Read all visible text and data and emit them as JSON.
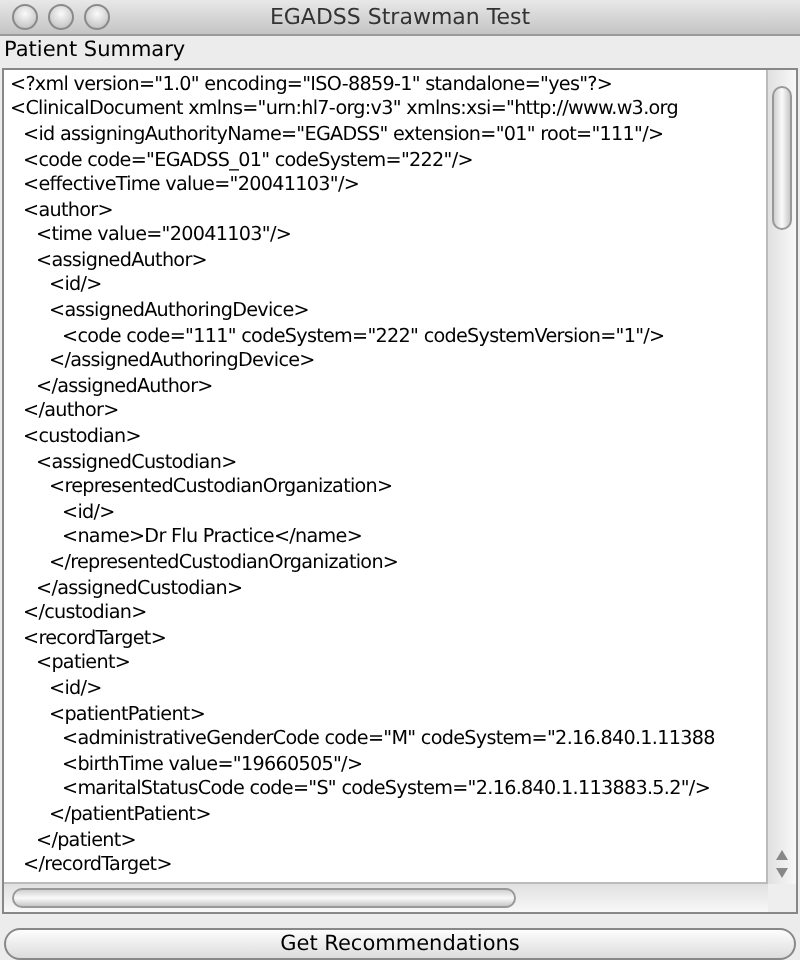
{
  "window": {
    "title": "EGADSS Strawman Test"
  },
  "panel_label": "Patient Summary",
  "document": {
    "lines": [
      {
        "text": "<?xml version=\"1.0\" encoding=\"ISO-8859-1\" standalone=\"yes\"?>"
      },
      {
        "text": "<ClinicalDocument xmlns=\"urn:hl7-org:v3\" xmlns:xsi=\"http://www.w3.org",
        "children": [
          {
            "text": "<id assigningAuthorityName=\"EGADSS\" extension=\"01\" root=\"111\"/>"
          },
          {
            "text": "<code code=\"EGADSS_01\" codeSystem=\"222\"/>"
          },
          {
            "text": "<effectiveTime value=\"20041103\"/>"
          },
          {
            "text": "<author>",
            "children": [
              {
                "text": "<time value=\"20041103\"/>"
              },
              {
                "text": "<assignedAuthor>",
                "children": [
                  {
                    "text": "<id/>"
                  },
                  {
                    "text": "<assignedAuthoringDevice>",
                    "children": [
                      {
                        "text": "<code code=\"111\" codeSystem=\"222\" codeSystemVersion=\"1\"/>"
                      }
                    ]
                  },
                  {
                    "text": "</assignedAuthoringDevice>"
                  }
                ]
              },
              {
                "text": "</assignedAuthor>"
              }
            ]
          },
          {
            "text": "</author>"
          },
          {
            "text": "<custodian>",
            "children": [
              {
                "text": "<assignedCustodian>",
                "children": [
                  {
                    "text": "<representedCustodianOrganization>",
                    "children": [
                      {
                        "text": "<id/>"
                      },
                      {
                        "text": "<name>Dr Flu Practice</name>"
                      }
                    ]
                  },
                  {
                    "text": "</representedCustodianOrganization>"
                  }
                ]
              },
              {
                "text": "</assignedCustodian>"
              }
            ]
          },
          {
            "text": "</custodian>"
          },
          {
            "text": "<recordTarget>",
            "children": [
              {
                "text": "<patient>",
                "children": [
                  {
                    "text": "<id/>"
                  },
                  {
                    "text": "<patientPatient>",
                    "children": [
                      {
                        "text": "<administrativeGenderCode code=\"M\" codeSystem=\"2.16.840.1.11388"
                      },
                      {
                        "text": "<birthTime value=\"19660505\"/>"
                      },
                      {
                        "text": "<maritalStatusCode code=\"S\" codeSystem=\"2.16.840.1.113883.5.2\"/>"
                      }
                    ]
                  },
                  {
                    "text": "</patientPatient>"
                  }
                ]
              },
              {
                "text": "</patient>"
              }
            ]
          },
          {
            "text": "</recordTarget>"
          }
        ]
      }
    ]
  },
  "button": "Get Recommendations"
}
